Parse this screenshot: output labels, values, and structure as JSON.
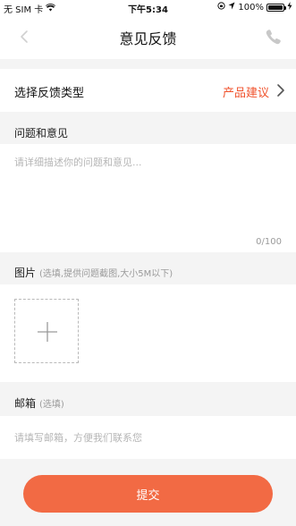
{
  "status_bar": {
    "carrier": "无 SIM 卡",
    "time": "下午5:34",
    "battery_percent": "100%",
    "battery_level": 1.0,
    "icons": [
      "wifi-icon",
      "lock-rotation-icon",
      "location-icon",
      "battery-icon",
      "charging-icon"
    ]
  },
  "nav": {
    "title": "意见反馈",
    "back_icon": "chevron-left-icon",
    "phone_icon": "phone-icon"
  },
  "feedback_type": {
    "label": "选择反馈类型",
    "value": "产品建议",
    "chevron_icon": "chevron-right-icon"
  },
  "issue": {
    "label": "问题和意见",
    "placeholder": "请详细描述你的问题和意见...",
    "value": "",
    "counter": "0/100"
  },
  "images": {
    "label": "图片",
    "hint": "(选填,提供问题截图,大小5M以下)",
    "add_icon": "plus-icon"
  },
  "email": {
    "label": "邮箱",
    "hint": "(选填)",
    "placeholder": "请填写邮箱，方便我们联系您",
    "value": ""
  },
  "submit": {
    "label": "提交"
  },
  "colors": {
    "accent": "#f0522c",
    "submit_background": "#f26a44",
    "page_background": "#f4f4f4",
    "muted_icon": "#d0d0d0"
  }
}
